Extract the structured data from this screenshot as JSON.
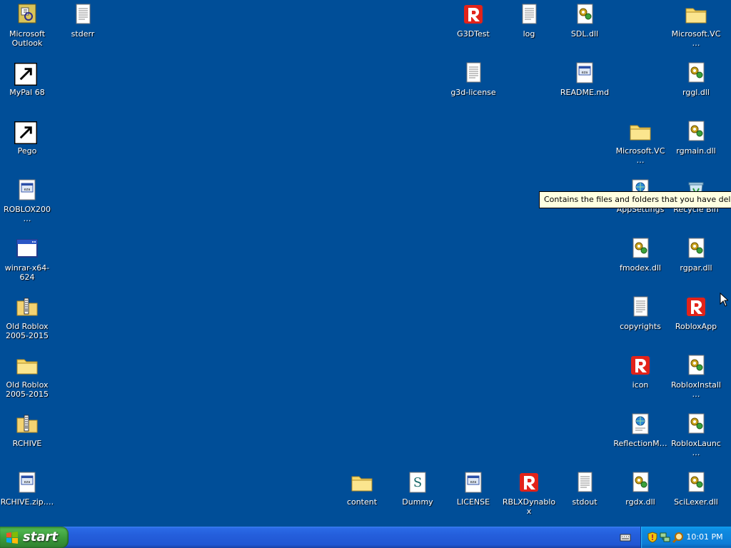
{
  "desktop": {
    "icons": [
      {
        "label": "Microsoft\nOutlook",
        "icon": "outlook-icon"
      },
      {
        "label": "stderr",
        "icon": "text-file-icon"
      },
      {
        "label": "G3DTest",
        "icon": "roblox-icon"
      },
      {
        "label": "log",
        "icon": "text-file-icon"
      },
      {
        "label": "SDL.dll",
        "icon": "dll-icon"
      },
      {
        "label": "Microsoft.VC…",
        "icon": "folder-icon"
      },
      {
        "label": "MyPal 68",
        "icon": "mypal-icon"
      },
      {
        "label": "g3d-license",
        "icon": "text-file-icon"
      },
      {
        "label": "README.md",
        "icon": "document-icon"
      },
      {
        "label": "rggl.dll",
        "icon": "dll-icon"
      },
      {
        "label": "Pego",
        "icon": "pego-icon"
      },
      {
        "label": "Microsoft.VC…",
        "icon": "folder-icon"
      },
      {
        "label": "rgmain.dll",
        "icon": "dll-icon"
      },
      {
        "label": "ROBLOX200…",
        "icon": "document-icon"
      },
      {
        "label": "AppSettings",
        "icon": "xml-icon"
      },
      {
        "label": "Recycle Bin",
        "icon": "recycle-bin-icon"
      },
      {
        "label": "winrar-x64-624",
        "icon": "application-icon"
      },
      {
        "label": "fmodex.dll",
        "icon": "dll-icon"
      },
      {
        "label": "rgpar.dll",
        "icon": "dll-icon"
      },
      {
        "label": "Old Roblox\n2005-2015",
        "icon": "zip-folder-icon"
      },
      {
        "label": "copyrights",
        "icon": "text-file-icon"
      },
      {
        "label": "RobloxApp",
        "icon": "roblox-icon"
      },
      {
        "label": "Old Roblox\n2005-2015",
        "icon": "folder-icon"
      },
      {
        "label": "icon",
        "icon": "roblox-icon"
      },
      {
        "label": "RobloxInstall…",
        "icon": "dll-icon"
      },
      {
        "label": "RCHIVE",
        "icon": "zip-folder-icon"
      },
      {
        "label": "ReflectionM…",
        "icon": "xml-icon"
      },
      {
        "label": "RobloxLaunc…",
        "icon": "dll-icon"
      },
      {
        "label": "RCHIVE.zip.…",
        "icon": "document-icon"
      },
      {
        "label": "content",
        "icon": "folder-icon"
      },
      {
        "label": "Dummy",
        "icon": "script-icon"
      },
      {
        "label": "LICENSE",
        "icon": "document-icon"
      },
      {
        "label": "RBLXDynablox",
        "icon": "roblox-icon"
      },
      {
        "label": "stdout",
        "icon": "text-file-icon"
      },
      {
        "label": "rgdx.dll",
        "icon": "dll-icon"
      },
      {
        "label": "SciLexer.dll",
        "icon": "dll-icon"
      }
    ]
  },
  "tooltip": {
    "text": "Contains the files and folders that you have deleted."
  },
  "taskbar": {
    "start_label": "start",
    "tray": {
      "clock": "10:01 PM",
      "icons": [
        "security-shield-icon",
        "network-icon",
        "search-icon"
      ]
    }
  },
  "colors": {
    "desktop": "#004e98",
    "taskbar": "#245edb",
    "start": "#3a9b3a",
    "tray": "#0d7cd6"
  }
}
